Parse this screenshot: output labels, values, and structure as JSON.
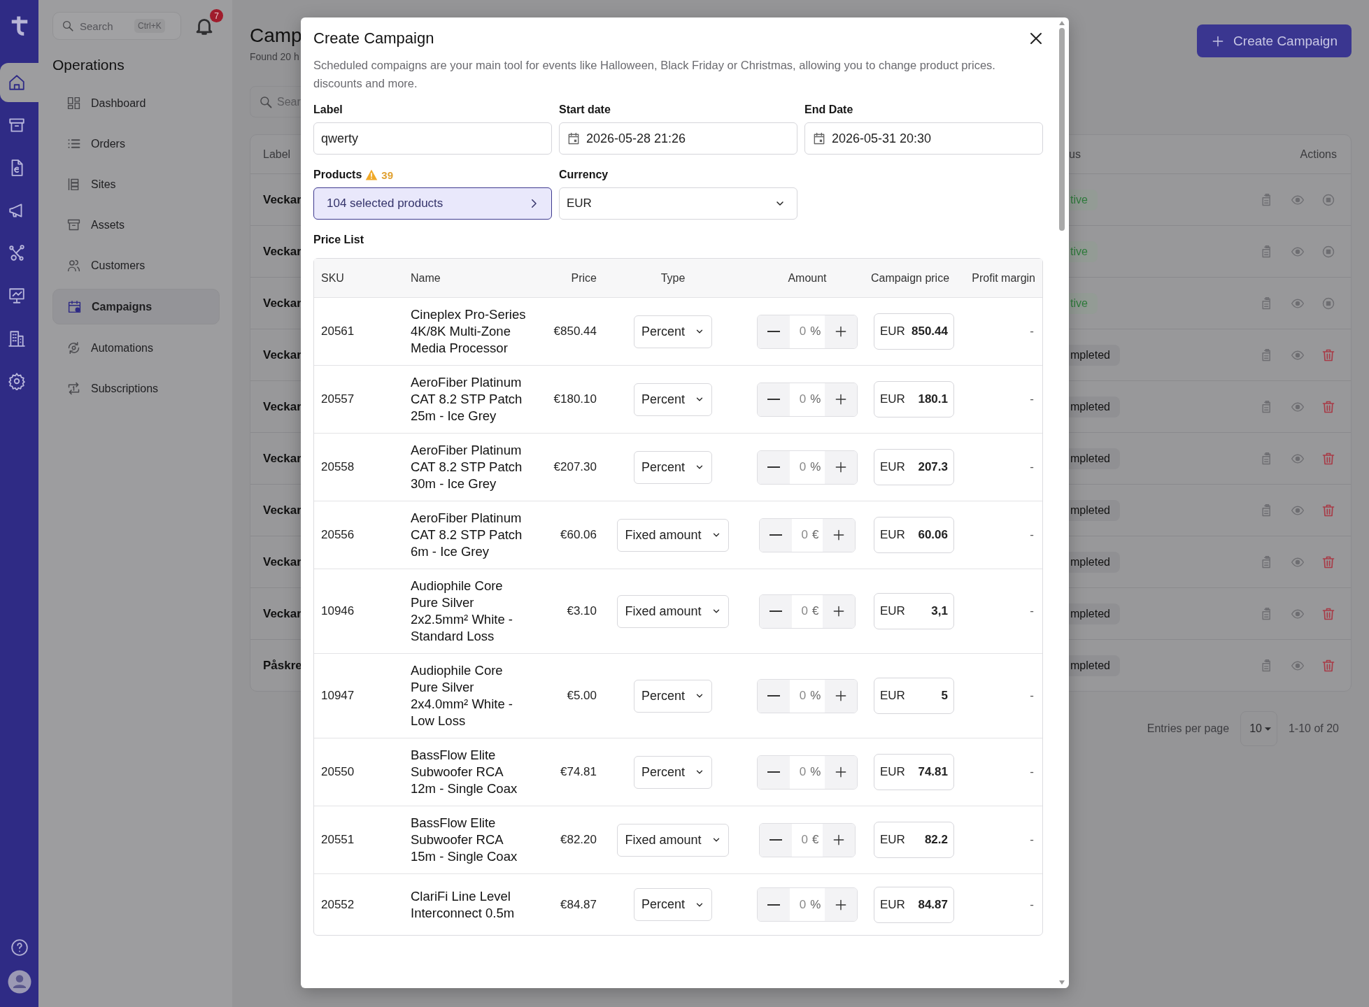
{
  "rail": {
    "items": [
      {
        "selected": true
      },
      {
        "selected": false
      },
      {
        "selected": false
      },
      {
        "selected": false
      },
      {
        "selected": false
      },
      {
        "selected": false
      },
      {
        "selected": false
      },
      {
        "selected": false
      }
    ]
  },
  "sidebar": {
    "search": {
      "placeholder": "Search",
      "shortcut": "Ctrl+K"
    },
    "notifications": "7",
    "title": "Operations",
    "items": [
      {
        "label": "Dashboard",
        "selected": false
      },
      {
        "label": "Orders",
        "selected": false
      },
      {
        "label": "Sites",
        "selected": false
      },
      {
        "label": "Assets",
        "selected": false
      },
      {
        "label": "Customers",
        "selected": false
      },
      {
        "label": "Campaigns",
        "selected": true
      },
      {
        "label": "Automations",
        "selected": false
      },
      {
        "label": "Subscriptions",
        "selected": false
      }
    ]
  },
  "page": {
    "title": "Camp",
    "subtitle": "Found 20 h",
    "search_placeholder": "Sear",
    "create_button": "Create Campaign"
  },
  "campaigns_table": {
    "columns": [
      "Label",
      "us",
      "Actions"
    ],
    "rows": [
      {
        "label": "Veckar",
        "status": "tive",
        "kind": "active"
      },
      {
        "label": "Veckar",
        "status": "tive",
        "kind": "active"
      },
      {
        "label": "Veckar",
        "status": "tive",
        "kind": "active"
      },
      {
        "label": "Veckar",
        "status": "mpleted",
        "kind": "completed"
      },
      {
        "label": "Veckar",
        "status": "mpleted",
        "kind": "completed"
      },
      {
        "label": "Veckar",
        "status": "mpleted",
        "kind": "completed"
      },
      {
        "label": "Veckar",
        "status": "mpleted",
        "kind": "completed"
      },
      {
        "label": "Veckar",
        "status": "mpleted",
        "kind": "completed"
      },
      {
        "label": "Veckar",
        "status": "mpleted",
        "kind": "completed"
      },
      {
        "label": "Påskre",
        "status": "mpleted",
        "kind": "completed"
      }
    ]
  },
  "pagination": {
    "entries_label": "Entries per page",
    "per_page": "10",
    "range": "1-10 of 20"
  },
  "modal": {
    "title": "Create Campaign",
    "description": "Scheduled compaigns are your main tool for events like Halloween, Black Friday or Christmas, allowing you to change product prices. discounts and more.",
    "label_field": {
      "label": "Label",
      "value": "qwerty"
    },
    "start_date": {
      "label": "Start date",
      "value": "2026-05-28 21:26"
    },
    "end_date": {
      "label": "End Date",
      "value": "2026-05-31 20:30"
    },
    "products": {
      "label": "Products",
      "warning_count": "39",
      "value": "104 selected products"
    },
    "currency": {
      "label": "Currency",
      "value": "EUR"
    },
    "price_list": {
      "title": "Price List",
      "columns": [
        "SKU",
        "Name",
        "Price",
        "Type",
        "Amount",
        "Campaign price",
        "Profit margin"
      ],
      "rows": [
        {
          "sku": "20561",
          "name": "Cineplex Pro-Series 4K/8K Multi-Zone Media Processor",
          "price": "€850.44",
          "type": "Percent",
          "amount": "0",
          "unit": "%",
          "currency": "EUR",
          "campaign_price": "850.44",
          "profit_margin": "-"
        },
        {
          "sku": "20557",
          "name": "AeroFiber Platinum CAT 8.2 STP Patch 25m - Ice Grey",
          "price": "€180.10",
          "type": "Percent",
          "amount": "0",
          "unit": "%",
          "currency": "EUR",
          "campaign_price": "180.1",
          "profit_margin": "-"
        },
        {
          "sku": "20558",
          "name": "AeroFiber Platinum CAT 8.2 STP Patch 30m - Ice Grey",
          "price": "€207.30",
          "type": "Percent",
          "amount": "0",
          "unit": "%",
          "currency": "EUR",
          "campaign_price": "207.3",
          "profit_margin": "-"
        },
        {
          "sku": "20556",
          "name": "AeroFiber Platinum CAT 8.2 STP Patch 6m - Ice Grey",
          "price": "€60.06",
          "type": "Fixed amount",
          "amount": "0",
          "unit": "€",
          "currency": "EUR",
          "campaign_price": "60.06",
          "profit_margin": "-"
        },
        {
          "sku": "10946",
          "name": "Audiophile Core Pure Silver 2x2.5mm² White - Standard Loss",
          "price": "€3.10",
          "type": "Fixed amount",
          "amount": "0",
          "unit": "€",
          "currency": "EUR",
          "campaign_price": "3,1",
          "profit_margin": "-"
        },
        {
          "sku": "10947",
          "name": "Audiophile Core Pure Silver 2x4.0mm² White - Low Loss",
          "price": "€5.00",
          "type": "Percent",
          "amount": "0",
          "unit": "%",
          "currency": "EUR",
          "campaign_price": "5",
          "profit_margin": "-"
        },
        {
          "sku": "20550",
          "name": "BassFlow Elite Subwoofer RCA 12m - Single Coax",
          "price": "€74.81",
          "type": "Percent",
          "amount": "0",
          "unit": "%",
          "currency": "EUR",
          "campaign_price": "74.81",
          "profit_margin": "-"
        },
        {
          "sku": "20551",
          "name": "BassFlow Elite Subwoofer RCA 15m - Single Coax",
          "price": "€82.20",
          "type": "Fixed amount",
          "amount": "0",
          "unit": "€",
          "currency": "EUR",
          "campaign_price": "82.2",
          "profit_margin": "-"
        },
        {
          "sku": "20552",
          "name": "ClariFi Line Level Interconnect 0.5m",
          "price": "€84.87",
          "type": "Percent",
          "amount": "0",
          "unit": "%",
          "currency": "EUR",
          "campaign_price": "84.87",
          "profit_margin": "-"
        }
      ]
    }
  }
}
